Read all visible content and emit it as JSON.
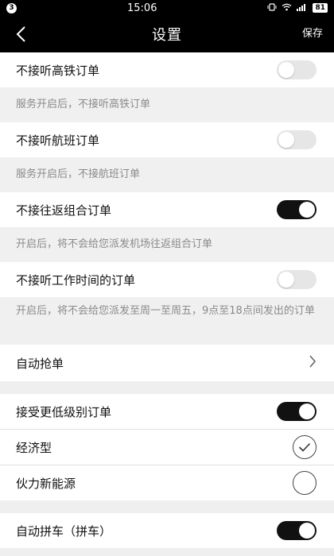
{
  "status_bar": {
    "notification_count": "3",
    "time": "15:06",
    "battery": "81",
    "icons": [
      "vibrate-icon",
      "wifi-icon",
      "signal-icon",
      "battery-icon"
    ]
  },
  "nav": {
    "back_icon": "chevron-left-icon",
    "title": "设置",
    "save_label": "保存"
  },
  "settings": {
    "high_speed_rail": {
      "label": "不接听高铁订单",
      "on": false,
      "description": "服务开启后，不接听高铁订单"
    },
    "flight": {
      "label": "不接听航班订单",
      "on": false,
      "description": "服务开启后，不接航班订单"
    },
    "round_trip": {
      "label": "不接往返组合订单",
      "on": true,
      "description": "开启后，将不会给您派发机场往返组合订单"
    },
    "work_hours": {
      "label": "不接听工作时间的订单",
      "on": false,
      "description": "开启后，将不会给您派发至周一至周五，9点至18点间发出的订单"
    },
    "auto_grab": {
      "label": "自动抢单",
      "icon": "chevron-right-icon"
    },
    "lower_level": {
      "label": "接受更低级别订单",
      "on": true
    },
    "economy": {
      "label": "经济型",
      "checked": true
    },
    "huoli": {
      "label": "伙力新能源",
      "checked": false
    },
    "carpool": {
      "label": "自动拼车（拼车）",
      "on": true
    }
  },
  "colors": {
    "toggle_on": "#111111",
    "toggle_off": "#e6e6e6",
    "nav_bg": "#000000"
  }
}
